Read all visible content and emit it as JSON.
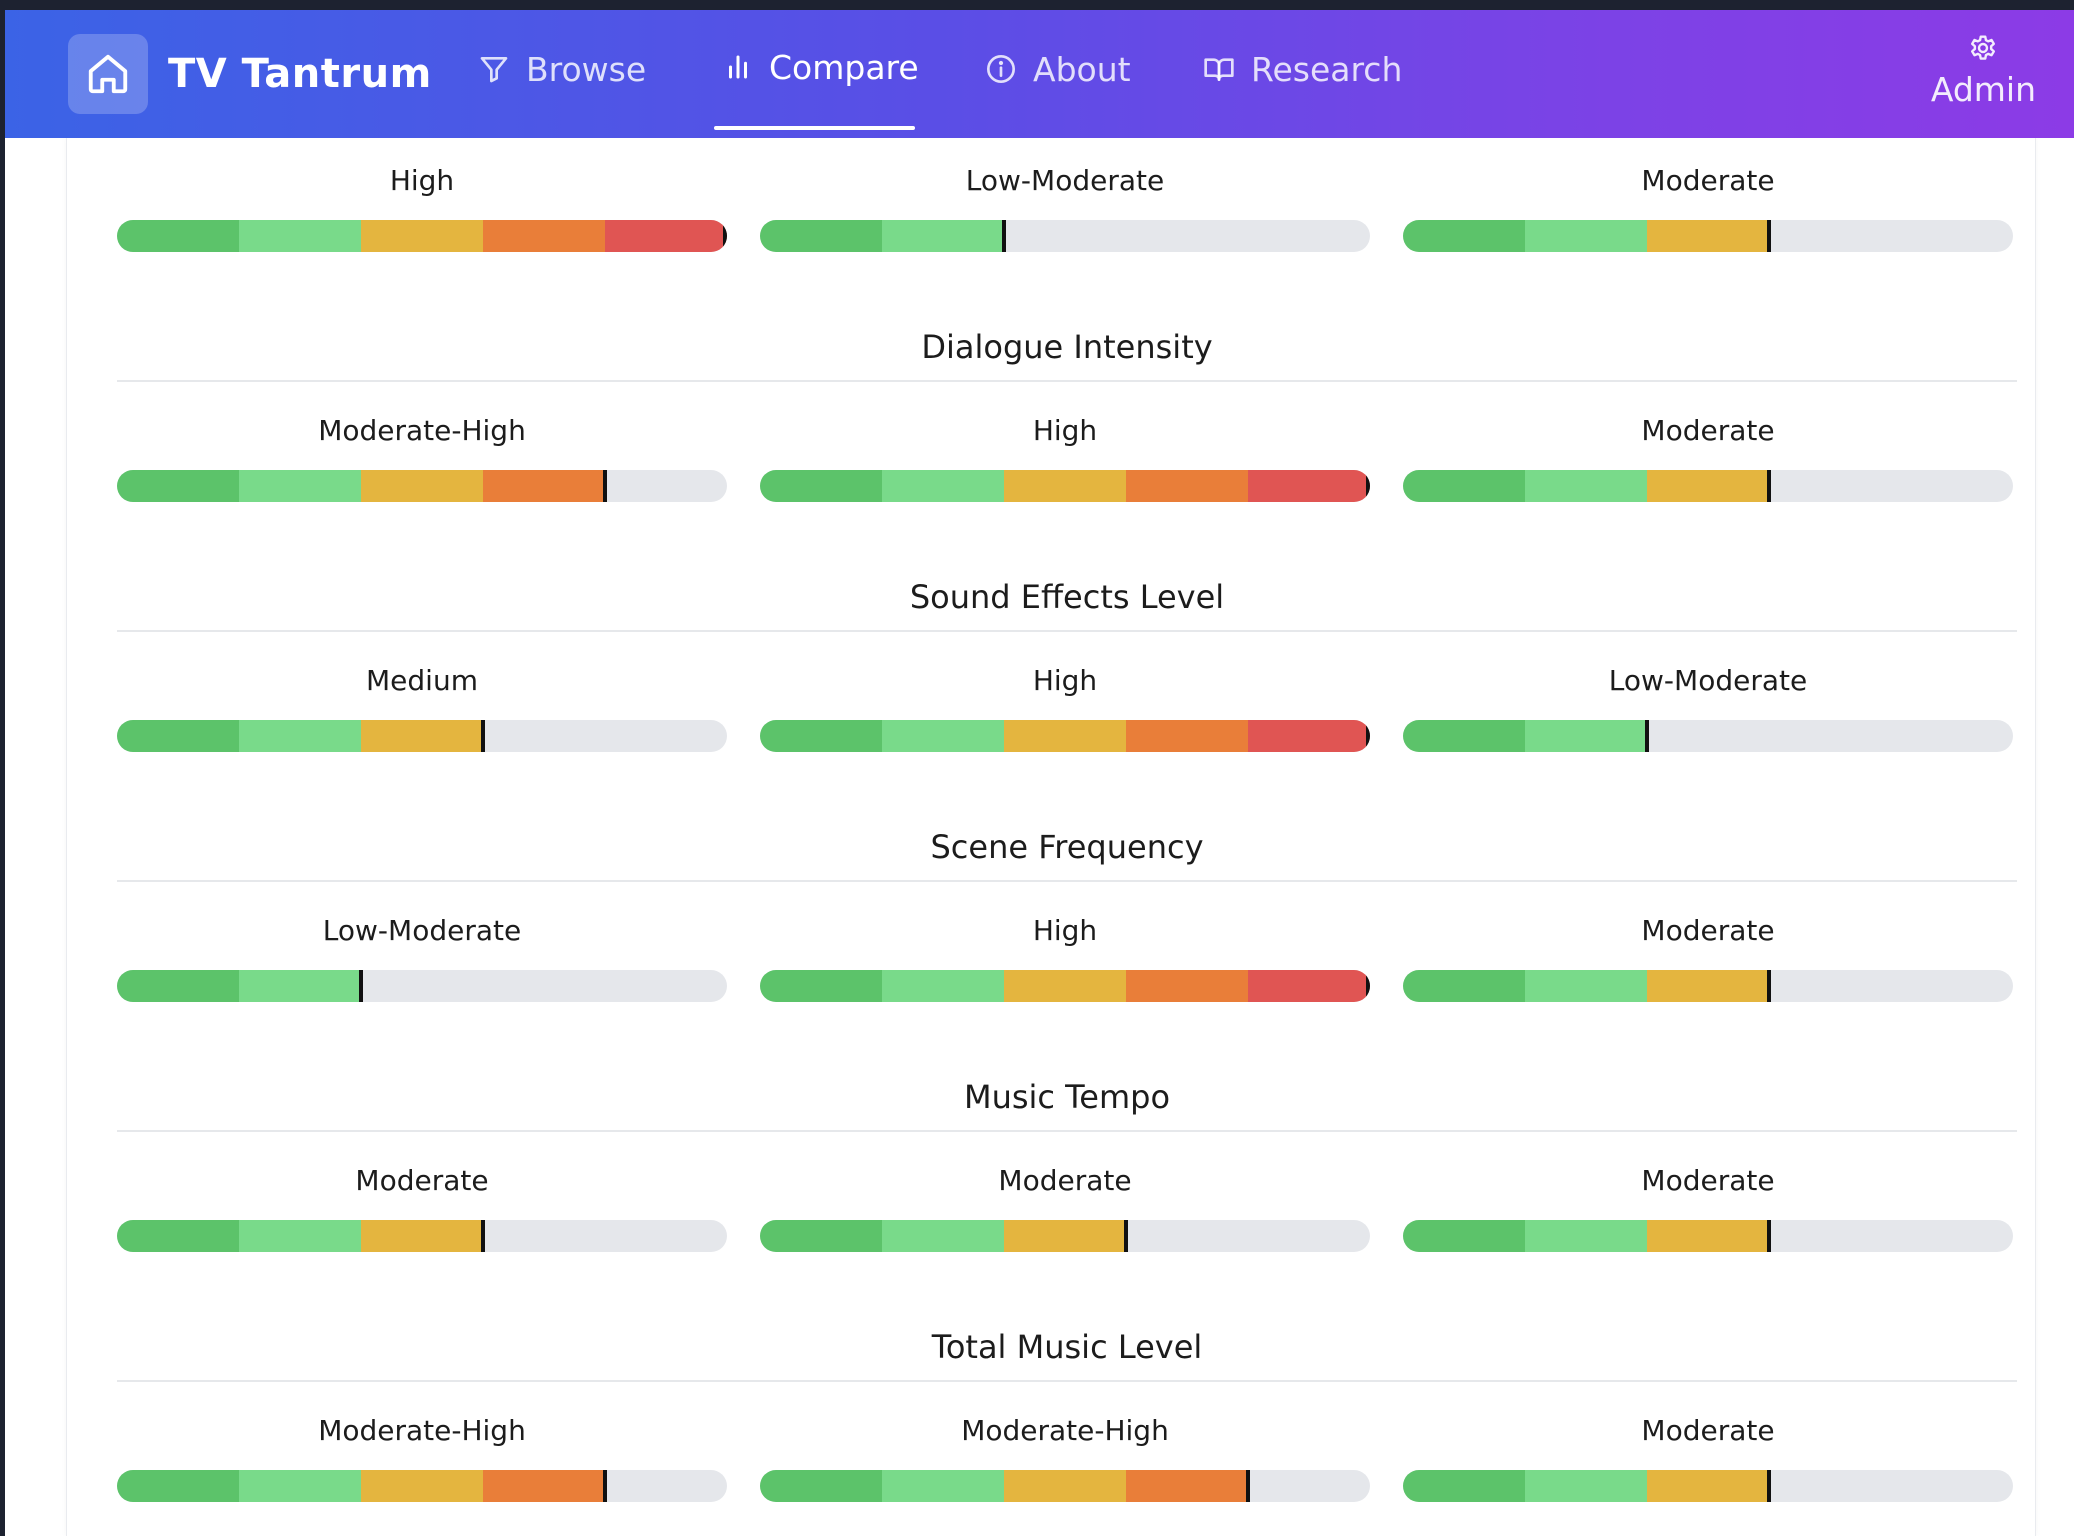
{
  "app": {
    "name": "TV Tantrum"
  },
  "nav": {
    "browse": "Browse",
    "compare": "Compare",
    "about": "About",
    "research": "Research",
    "admin": "Admin",
    "active": "compare"
  },
  "scale": {
    "segment_colors": [
      "#5cc36a",
      "#79da8a",
      "#e4b53f",
      "#e97e39",
      "#e05553"
    ],
    "track_color": "#e5e7eb"
  },
  "top_row": {
    "cells": [
      {
        "label": "High",
        "level": 5
      },
      {
        "label": "Low-Moderate",
        "level": 2
      },
      {
        "label": "Moderate",
        "level": 3
      }
    ]
  },
  "sections": [
    {
      "title": "Dialogue Intensity",
      "cells": [
        {
          "label": "Moderate-High",
          "level": 4
        },
        {
          "label": "High",
          "level": 5
        },
        {
          "label": "Moderate",
          "level": 3
        }
      ]
    },
    {
      "title": "Sound Effects Level",
      "cells": [
        {
          "label": "Medium",
          "level": 3
        },
        {
          "label": "High",
          "level": 5
        },
        {
          "label": "Low-Moderate",
          "level": 2
        }
      ]
    },
    {
      "title": "Scene Frequency",
      "cells": [
        {
          "label": "Low-Moderate",
          "level": 2
        },
        {
          "label": "High",
          "level": 5
        },
        {
          "label": "Moderate",
          "level": 3
        }
      ]
    },
    {
      "title": "Music Tempo",
      "cells": [
        {
          "label": "Moderate",
          "level": 3
        },
        {
          "label": "Moderate",
          "level": 3
        },
        {
          "label": "Moderate",
          "level": 3
        }
      ]
    },
    {
      "title": "Total Music Level",
      "cells": [
        {
          "label": "Moderate-High",
          "level": 4
        },
        {
          "label": "Moderate-High",
          "level": 4
        },
        {
          "label": "Moderate",
          "level": 3
        }
      ]
    }
  ]
}
